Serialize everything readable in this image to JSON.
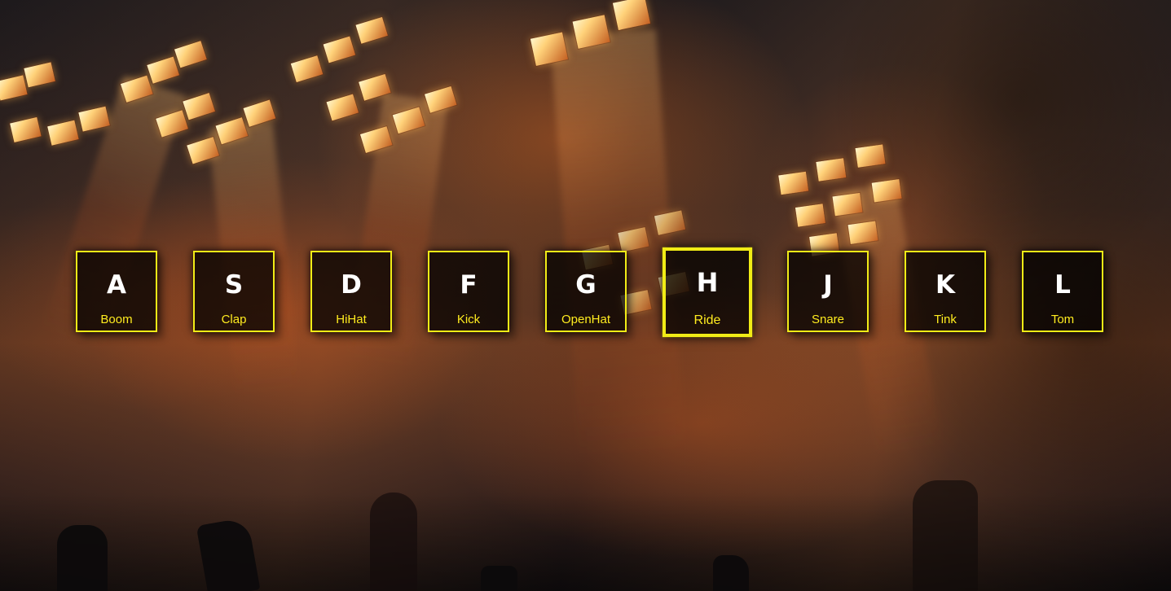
{
  "theme": {
    "key_border": "#f1ec16",
    "sound_text": "#ffec1f",
    "letter_text": "#ffffff",
    "key_background": "rgba(0, 0, 0, .74)"
  },
  "keys": [
    {
      "letter": "A",
      "sound": "Boom",
      "active": false
    },
    {
      "letter": "S",
      "sound": "Clap",
      "active": false
    },
    {
      "letter": "D",
      "sound": "HiHat",
      "active": false
    },
    {
      "letter": "F",
      "sound": "Kick",
      "active": false
    },
    {
      "letter": "G",
      "sound": "OpenHat",
      "active": false
    },
    {
      "letter": "H",
      "sound": "Ride",
      "active": true
    },
    {
      "letter": "J",
      "sound": "Snare",
      "active": false
    },
    {
      "letter": "K",
      "sound": "Tink",
      "active": false
    },
    {
      "letter": "L",
      "sound": "Tom",
      "active": false
    }
  ],
  "background": {
    "scene": "concert-stage-photo",
    "accent": "#c46022"
  }
}
